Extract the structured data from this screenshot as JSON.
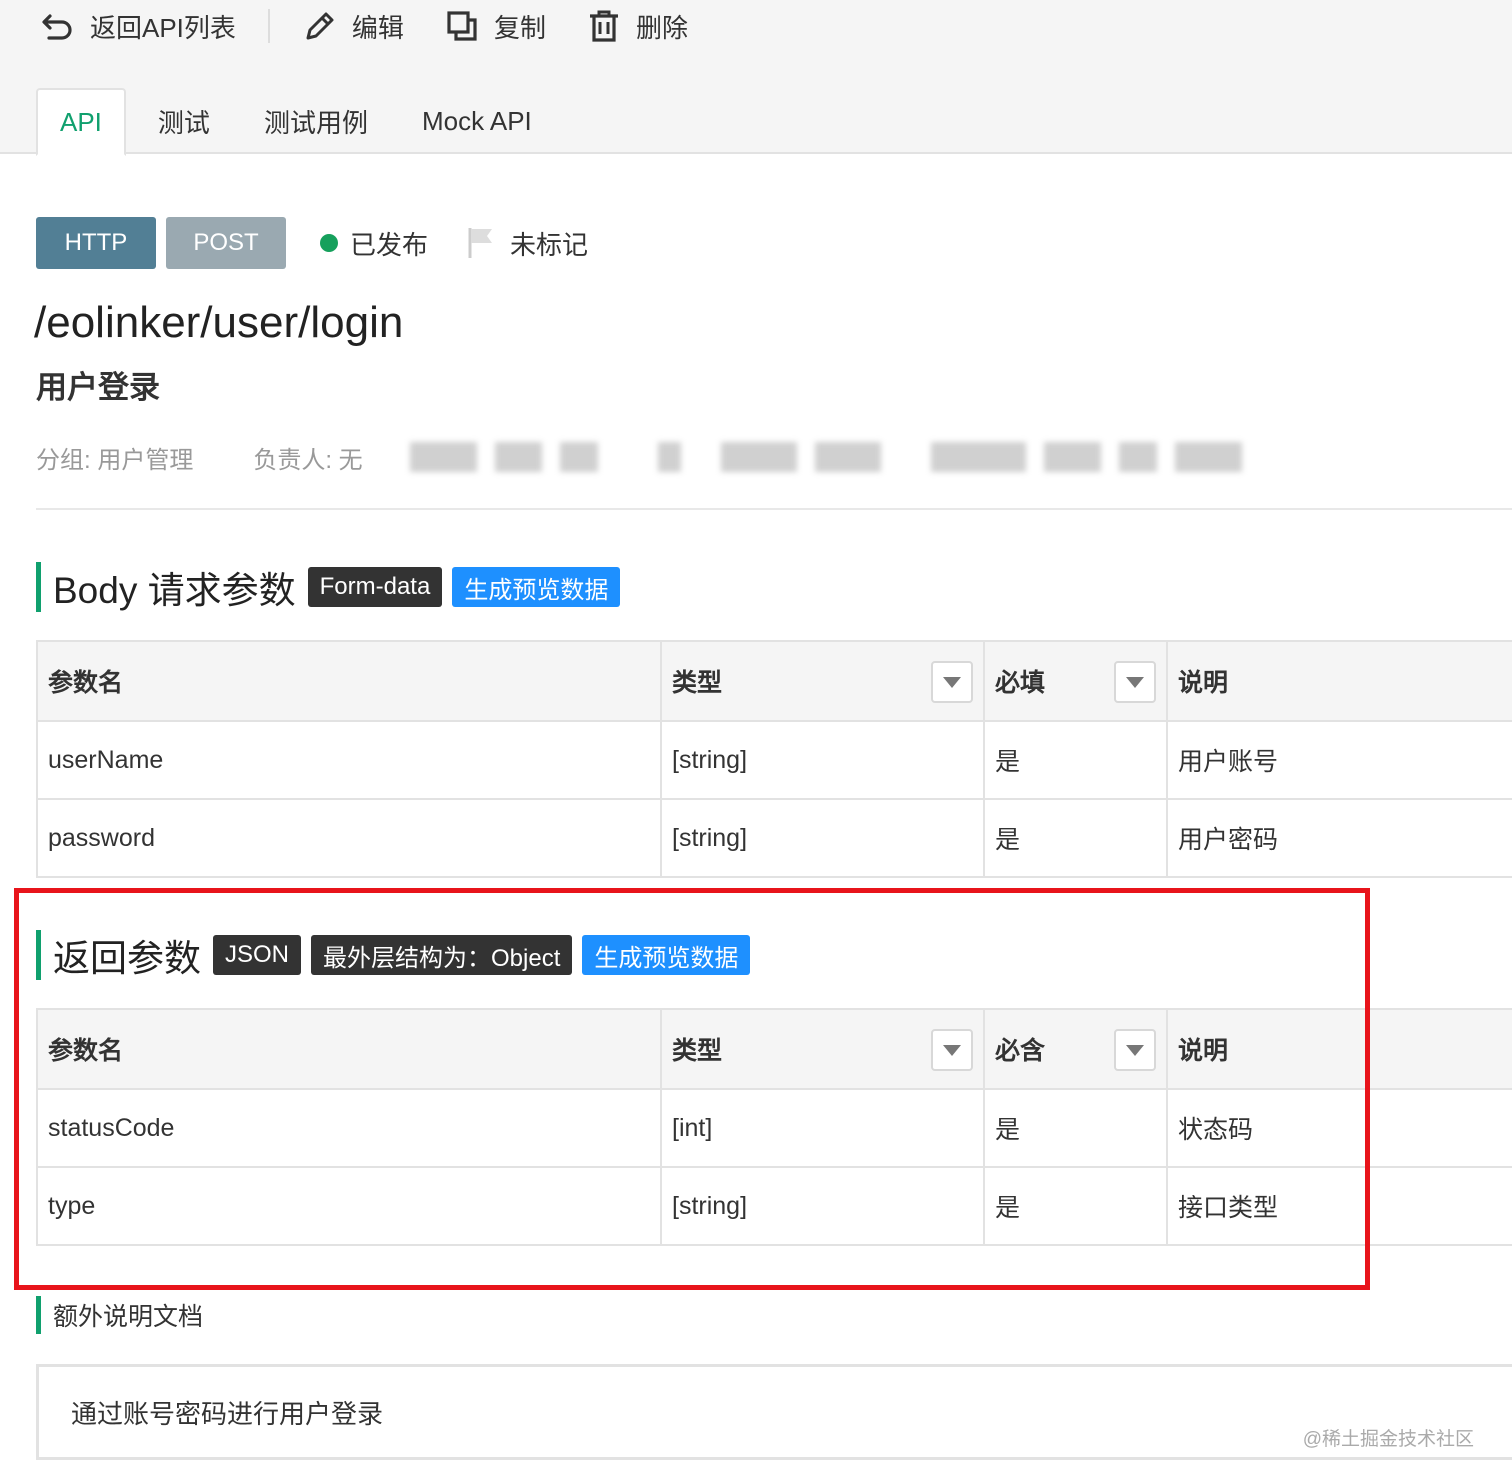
{
  "toolbar": {
    "back_label": "返回API列表",
    "edit_label": "编辑",
    "copy_label": "复制",
    "delete_label": "删除"
  },
  "tabs": [
    {
      "label": "API",
      "active": true
    },
    {
      "label": "测试",
      "active": false
    },
    {
      "label": "测试用例",
      "active": false
    },
    {
      "label": "Mock API",
      "active": false
    }
  ],
  "api": {
    "protocol": "HTTP",
    "method": "POST",
    "status": "已发布",
    "status_color": "#16a05c",
    "mark": "未标记",
    "path": "/eolinker/user/login",
    "name": "用户登录",
    "group": "分组: 用户管理",
    "owner": "负责人: 无"
  },
  "body_params": {
    "title": "Body 请求参数",
    "format_badge": "Form-data",
    "preview_button": "生成预览数据",
    "columns": [
      "参数名",
      "类型",
      "必填",
      "说明"
    ],
    "rows": [
      {
        "name": "userName",
        "type": "[string]",
        "required": "是",
        "desc": "用户账号"
      },
      {
        "name": "password",
        "type": "[string]",
        "required": "是",
        "desc": "用户密码"
      }
    ]
  },
  "return_params": {
    "title": "返回参数",
    "format_badge": "JSON",
    "structure_badge": "最外层结构为：Object",
    "preview_button": "生成预览数据",
    "columns": [
      "参数名",
      "类型",
      "必含",
      "说明"
    ],
    "rows": [
      {
        "name": "statusCode",
        "type": "[int]",
        "required": "是",
        "desc": "状态码"
      },
      {
        "name": "type",
        "type": "[string]",
        "required": "是",
        "desc": "接口类型"
      }
    ]
  },
  "extra_doc": {
    "title": "额外说明文档",
    "content": "通过账号密码进行用户登录"
  },
  "watermark": "@稀土掘金技术社区",
  "colors": {
    "accent_green": "#10a06e",
    "http_pill": "#527f95",
    "post_pill": "#9aa9b1",
    "preview_blue": "#1e90ff",
    "highlight_red": "#e8141b"
  }
}
